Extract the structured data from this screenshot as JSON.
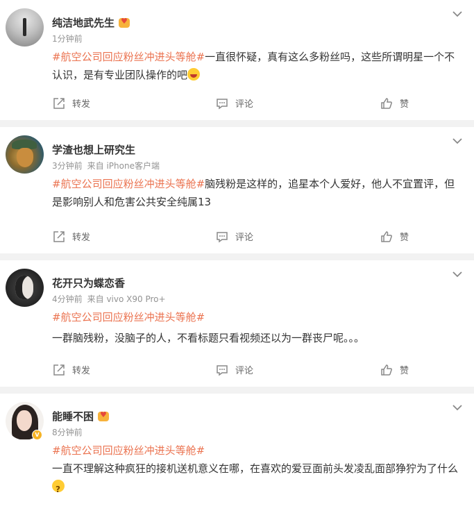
{
  "posts": [
    {
      "username": "纯洁地武先生",
      "time": "1分钟前",
      "source": "",
      "topic": "#航空公司回应粉丝冲进头等舱#",
      "text": "一直很怀疑，真有这么多粉丝吗，这些所谓明星一个不认识，是有专业团队操作的吧",
      "emoji": "laugh-emoji"
    },
    {
      "username": "学渣也想上研究生",
      "time": "3分钟前",
      "source": "来自 iPhone客户端",
      "topic": "#航空公司回应粉丝冲进头等舱#",
      "text": "脑残粉是这样的，追星本个人爱好，他人不宜置评，但是影响别人和危害公共安全纯属13"
    },
    {
      "username": "花开只为蝶恋香",
      "time": "4分钟前",
      "source": "来自 vivo X90 Pro+",
      "topic": "#航空公司回应粉丝冲进头等舱#",
      "text": "一群脑残粉，没脑子的人，不看标题只看视频还以为一群丧尸呢。。。"
    },
    {
      "username": "能睡不困",
      "time": "8分钟前",
      "source": "",
      "topic": "#航空公司回应粉丝冲进头等舱#",
      "text": "一直不理解这种疯狂的接机送机意义在哪，在喜欢的爱豆面前头发凌乱面部狰狞为了什么",
      "emoji": "thinking-emoji"
    }
  ],
  "actions": {
    "forward": "转发",
    "comment": "评论",
    "like": "赞"
  },
  "colors": {
    "topic": "#eb7350",
    "meta": "#939393",
    "background": "#f2f2f2"
  }
}
